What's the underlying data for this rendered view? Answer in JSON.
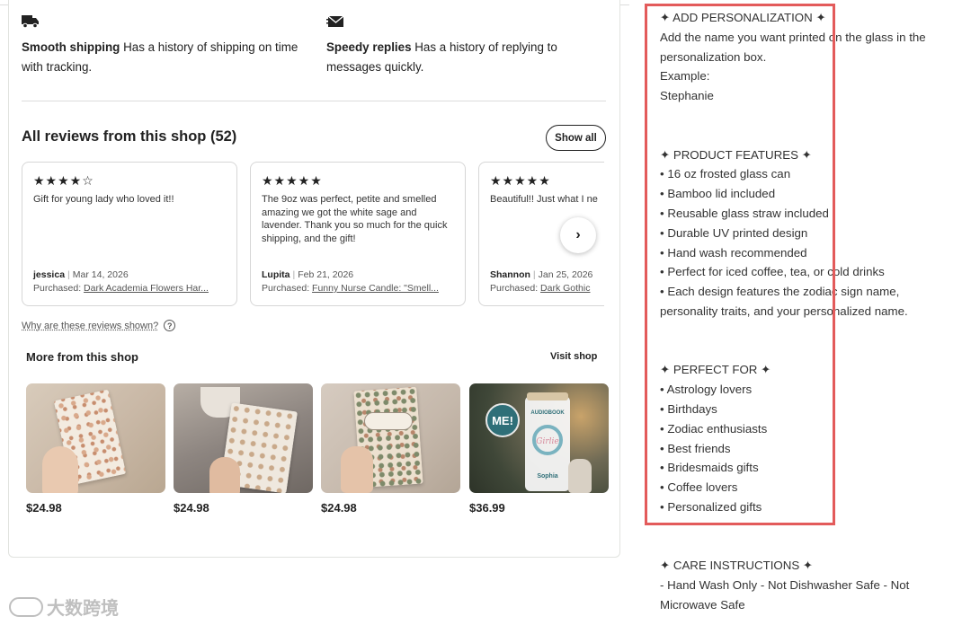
{
  "policies": [
    {
      "icon": "truck-icon",
      "title": "Smooth shipping",
      "text": "Has a history of shipping on time with tracking."
    },
    {
      "icon": "envelope-icon",
      "title": "Speedy replies",
      "text": "Has a history of replying to messages quickly."
    }
  ],
  "reviews": {
    "title": "All reviews from this shop (52)",
    "show_all": "Show all",
    "items": [
      {
        "stars": "★★★★☆",
        "text": "Gift for young lady who loved it!!",
        "author": "jessica",
        "date": "Mar 14, 2026",
        "purchased_label": "Purchased:",
        "purchased_item": "Dark Academia Flowers Har..."
      },
      {
        "stars": "★★★★★",
        "text": "The 9oz was perfect, petite and smelled amazing we got the white sage and lavender. Thank you so much for the quick shipping, and the gift!",
        "author": "Lupita",
        "date": "Feb 21, 2026",
        "purchased_label": "Purchased:",
        "purchased_item": "Funny Nurse Candle: \"Smell..."
      },
      {
        "stars": "★★★★★",
        "text": "Beautiful!! Just what I ne",
        "author": "Shannon",
        "date": "Jan 25, 2026",
        "purchased_label": "Purchased:",
        "purchased_item": "Dark Gothic"
      }
    ],
    "next": "›",
    "why_link": "Why are these reviews shown?",
    "help": "?"
  },
  "more": {
    "title": "More from this shop",
    "visit": "Visit shop",
    "products": [
      {
        "price": "$24.98"
      },
      {
        "price": "$24.98"
      },
      {
        "price": "$24.98"
      },
      {
        "price": "$36.99",
        "badge": "ME!",
        "can_text": "AUDIOBOOK",
        "can_sub": "Girlie",
        "can_name": "Sophia"
      }
    ]
  },
  "description": [
    "✦ ADD PERSONALIZATION ✦",
    "Add the name you want printed on the glass in the",
    "personalization box.",
    "Example:",
    "Stephanie",
    "",
    "",
    "✦ PRODUCT FEATURES ✦",
    "• 16 oz frosted glass can",
    "• Bamboo lid included",
    "• Reusable glass straw included",
    "• Durable UV printed design",
    "• Hand wash recommended",
    "• Perfect for iced coffee, tea, or cold drinks",
    "• Each design features the zodiac sign name,",
    "personality traits, and your personalized name.",
    "",
    "",
    "✦ PERFECT FOR ✦",
    "• Astrology lovers",
    "• Birthdays",
    "• Zodiac enthusiasts",
    "• Best friends",
    "• Bridesmaids gifts",
    "• Coffee lovers",
    "• Personalized gifts",
    "",
    "",
    "✦ CARE INSTRUCTIONS ✦",
    "- Hand Wash Only - Not Dishwasher Safe - Not",
    "Microwave Safe"
  ],
  "watermark": "大数跨境",
  "colors": {
    "highlight": "#e35b5b"
  }
}
